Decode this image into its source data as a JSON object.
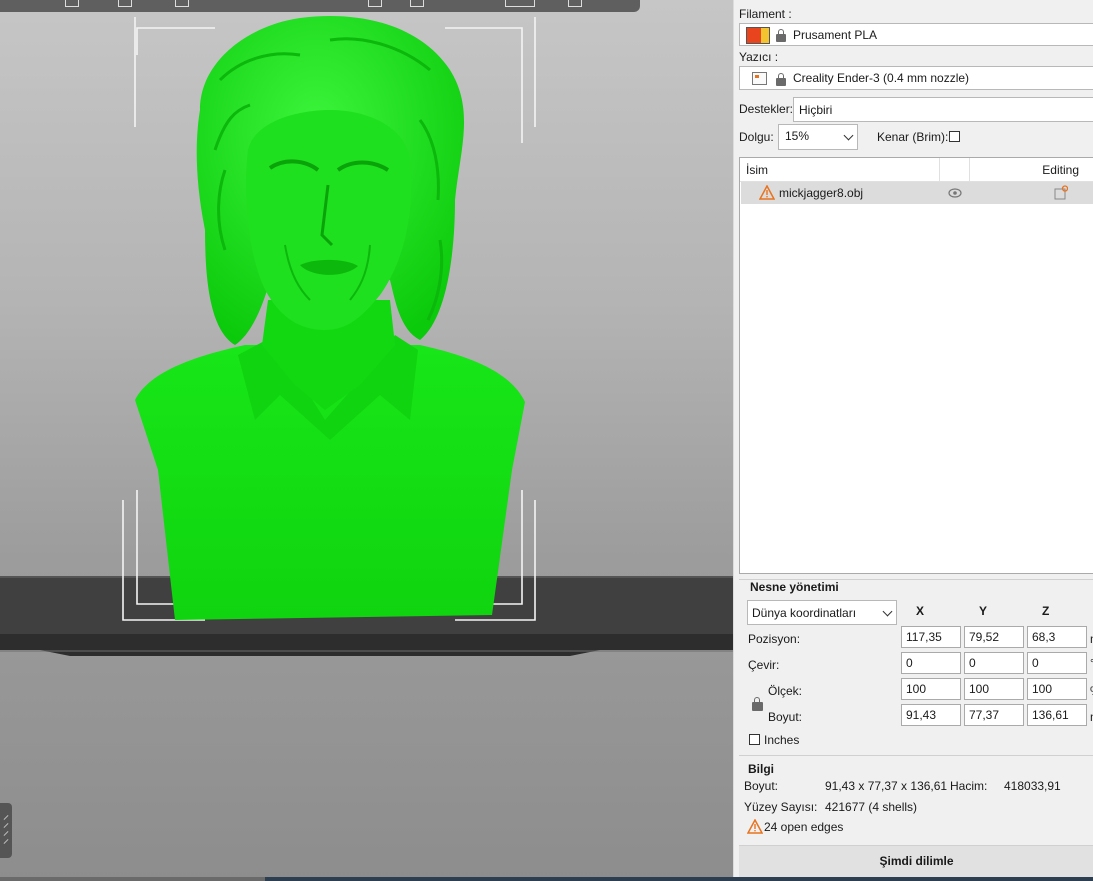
{
  "panel": {
    "filament": {
      "label": "Filament :",
      "value": "Prusament PLA",
      "swatch_colors": [
        "#e8451e",
        "#f4c430"
      ]
    },
    "printer": {
      "label": "Yazıcı :",
      "value": "Creality Ender-3 (0.4 mm nozzle)"
    },
    "supports": {
      "label": "Destekler:",
      "value": "Hiçbiri"
    },
    "infill": {
      "label": "Dolgu:",
      "value": "15%"
    },
    "brim": {
      "label": "Kenar (Brim):",
      "checked": false
    },
    "object_list": {
      "col_name": "İsim",
      "col_editing": "Editing",
      "items": [
        {
          "name": "mickjagger8.obj",
          "warning_icon": "warning-icon",
          "visibility_icon": "eye-icon",
          "edit_icon": "edit-icon"
        }
      ]
    },
    "manipulation": {
      "title": "Nesne yönetimi",
      "coord_system": "Dünya koordinatları",
      "axes": [
        "X",
        "Y",
        "Z"
      ],
      "rows": [
        {
          "label": "Pozisyon:",
          "values": [
            "117,35",
            "79,52",
            "68,3"
          ],
          "unit": "mm"
        },
        {
          "label": "Çevir:",
          "values": [
            "0",
            "0",
            "0"
          ],
          "unit": "°"
        },
        {
          "label": "Ölçek:",
          "values": [
            "100",
            "100",
            "100"
          ],
          "unit": "%"
        },
        {
          "label": "Boyut:",
          "values": [
            "91,43",
            "77,37",
            "136,61"
          ],
          "unit": "mm"
        }
      ],
      "inches_label": "Inches",
      "inches_checked": false
    },
    "info": {
      "title": "Bilgi",
      "size_label": "Boyut:",
      "size_value": "91,43 x 77,37 x 136,61",
      "volume_label": "Hacim:",
      "volume_value": "418033,91",
      "facets_label": "Yüzey Sayısı:",
      "facets_value": "421677 (4 shells)",
      "open_edges": "24 open edges"
    },
    "slice_button": "Şimdi dilimle"
  },
  "colors": {
    "model_green": "#13e313",
    "warning_orange": "#e8731e",
    "bed_dark": "#3a3a3a"
  }
}
